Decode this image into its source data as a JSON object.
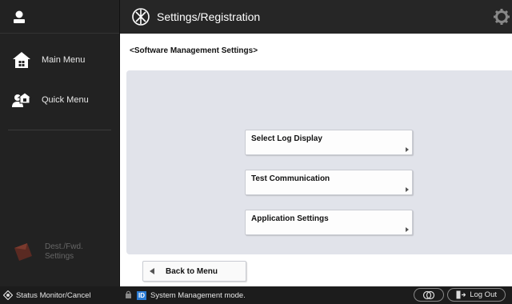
{
  "header": {
    "title": "Settings/Registration"
  },
  "sidebar": {
    "items": [
      {
        "label": "Main Menu"
      },
      {
        "label": "Quick Menu"
      }
    ],
    "dest_label_line1": "Dest./Fwd.",
    "dest_label_line2": "Settings"
  },
  "main": {
    "breadcrumb": "<Software Management Settings>",
    "buttons": [
      {
        "label": "Select Log Display"
      },
      {
        "label": "Test Communication"
      },
      {
        "label": "Application Settings"
      }
    ],
    "back_label": "Back to Menu"
  },
  "status": {
    "monitor_label": "Status Monitor/Cancel",
    "id_badge": "ID",
    "message": "System Management mode.",
    "logout_label": "Log Out"
  },
  "colors": {
    "panel": "#e1e3ea",
    "sidebar": "#222222",
    "id_badge": "#2a7bd4"
  }
}
